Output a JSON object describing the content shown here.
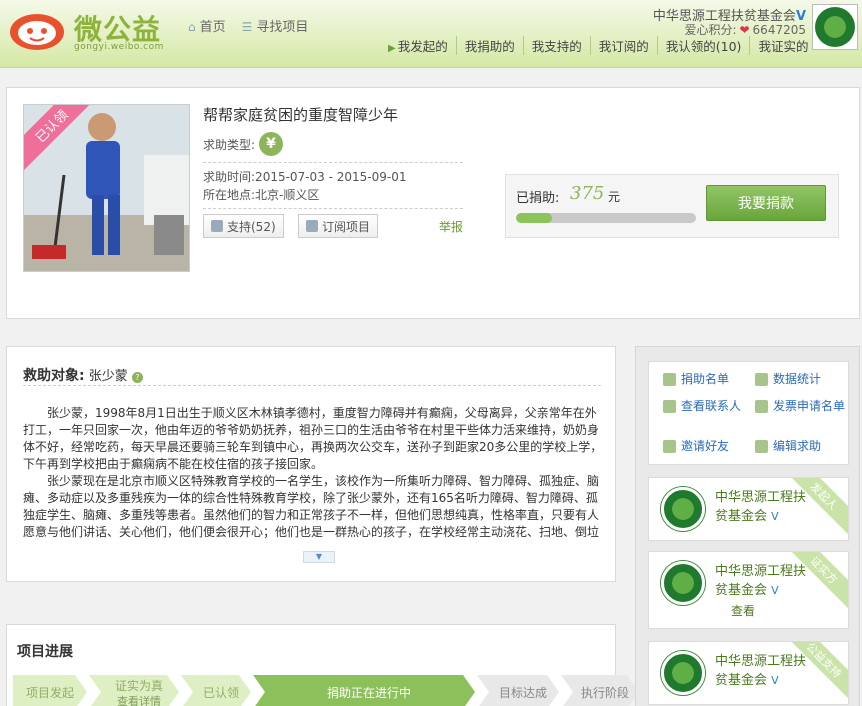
{
  "header": {
    "logo_text": "微公益",
    "logo_sub": "gongyi.weibo.com",
    "nav_home": "首页",
    "nav_find": "寻找项目",
    "org_name": "中华思源工程扶贫基金会",
    "score_label": "爱心积分:",
    "score_value": "6647205",
    "sub_nav": [
      "我发起的",
      "我捐助的",
      "我支持的",
      "我订阅的",
      "我认领的(10)",
      "我证实的"
    ]
  },
  "project": {
    "ribbon": "已认领",
    "title": "帮帮家庭贫困的重度智障少年",
    "type_label": "求助类型:",
    "type_icon": "¥",
    "time_label": "求助时间",
    "time_value": ":2015-07-03 - 2015-09-01",
    "loc_label": "所在地点",
    "loc_value": ":北京-顺义区",
    "support_label": "支持(52)",
    "subscribe_label": "订阅项目",
    "report_label": "举报",
    "donated_label": "已捐助:",
    "donated_amount": "375",
    "donated_unit": "元",
    "progress": 0.2,
    "donate_button": "我要捐款"
  },
  "detail": {
    "head_label": "救助对象:",
    "head_name": "张少蒙",
    "paragraphs": [
      "张少蒙，1998年8月1日出生于顺义区木林镇孝德村，重度智力障碍并有癫痫，父母离异，父亲常年在外打工，一年只回家一次，他由年迈的爷爷奶奶抚养，祖孙三口的生活由爷爷在村里干些体力活来维持，奶奶身体不好，经常吃药，每天早晨还要骑三轮车到镇中心，再换两次公交车，送孙子到距家20多公里的学校上学，下午再到学校把由于癫痫病不能在校住宿的孩子接回家。",
      "张少蒙现在是北京市顺义区特殊教育学校的一名学生，该校作为一所集听力障碍、智力障碍、孤独症、脑瘫、多动症以及多重残疾为一体的综合性特殊教育学校，除了张少蒙外，还有165名听力障碍、智力障碍、孤独症学生、脑瘫、多重残等患者。虽然他们的智力和正常孩子不一样，但他们思想纯真，性格率直，只要有人愿意与他们讲话、关心他们，他们便会很开心；他们也是一群热心的孩子，在学校经常主动浇花、扫地、倒垃"
    ]
  },
  "steps": {
    "title": "项目进展",
    "items": [
      {
        "label": "项目发起",
        "sub": ""
      },
      {
        "label": "证实为真",
        "sub": "查看详情"
      },
      {
        "label": "已认领",
        "sub": ""
      },
      {
        "label": "捐助正在进行中",
        "sub": ""
      },
      {
        "label": "目标达成",
        "sub": ""
      },
      {
        "label": "执行阶段",
        "sub": ""
      }
    ]
  },
  "sidebar": {
    "tools": [
      "捐助名单",
      "数据统计",
      "查看联系人",
      "发票申请名单",
      "邀请好友",
      "编辑求助"
    ],
    "cards": [
      {
        "name": "中华思源工程扶贫基金会",
        "tag": "发起人",
        "link": ""
      },
      {
        "name": "中华思源工程扶贫基金会",
        "tag": "证实方",
        "link": "查看"
      },
      {
        "name": "中华思源工程扶贫基金会",
        "tag": "公益支持",
        "link": ""
      }
    ]
  }
}
